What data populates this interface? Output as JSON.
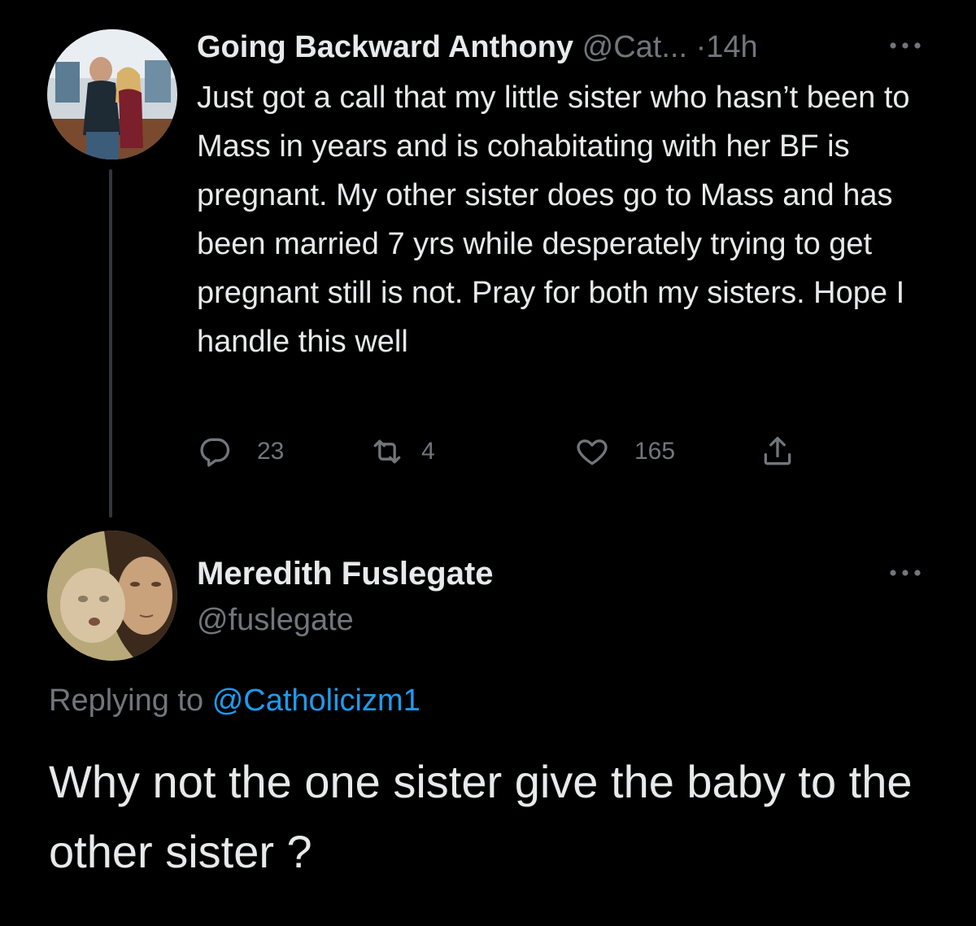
{
  "tweet": {
    "author_name": "Going Backward Anthony",
    "author_handle": "@Cat...",
    "separator": "·",
    "time": "14h",
    "text": "Just got a call that my little sister who hasn’t been to Mass in years and is cohabitating with her BF is pregnant. My other sister does go to Mass and has been married 7 yrs while desperately trying to get pregnant still is not. Pray for both my sisters. Hope I handle this well",
    "stats": {
      "replies": "23",
      "retweets": "4",
      "likes": "165"
    },
    "icons": {
      "reply": "reply-icon",
      "retweet": "retweet-icon",
      "like": "heart-icon",
      "share": "share-icon",
      "more": "more-icon"
    }
  },
  "reply": {
    "author_name": "Meredith Fuslegate",
    "author_handle": "@fuslegate",
    "replying_to_label": "Replying to",
    "replying_to_handle": "@Catholicizm1",
    "text": "Why not the one sister give the baby to the other sister ?"
  },
  "colors": {
    "background": "#000000",
    "primary_text": "#e7e9ea",
    "secondary_text": "#71767b",
    "link": "#1d9bf0",
    "thread_line": "#333639"
  }
}
